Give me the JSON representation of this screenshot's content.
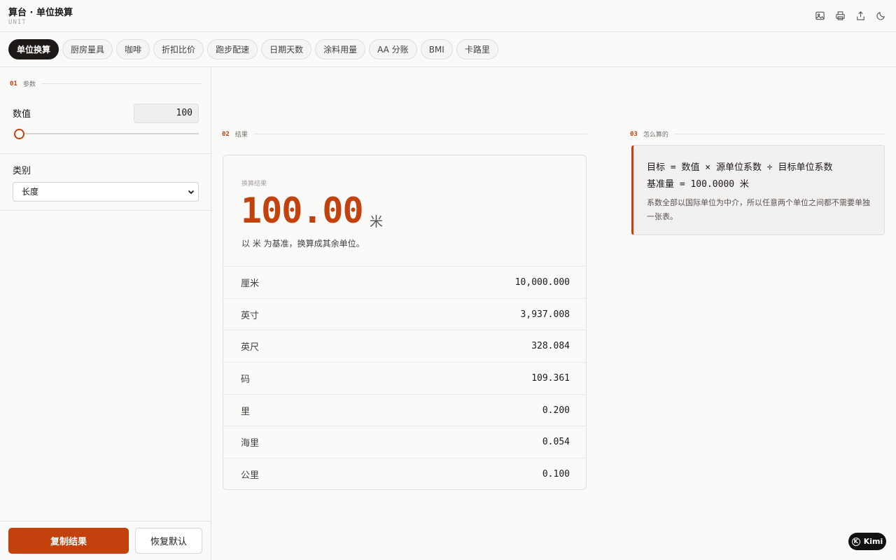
{
  "header": {
    "title": "算台 · 单位换算",
    "subtitle": "UNIT",
    "icons": [
      "image-icon",
      "print-icon",
      "share-icon",
      "moon-icon"
    ]
  },
  "tabs": [
    {
      "label": "单位换算",
      "active": true
    },
    {
      "label": "厨房量具",
      "active": false
    },
    {
      "label": "咖啡",
      "active": false
    },
    {
      "label": "折扣比价",
      "active": false
    },
    {
      "label": "跑步配速",
      "active": false
    },
    {
      "label": "日期天数",
      "active": false
    },
    {
      "label": "涂料用量",
      "active": false
    },
    {
      "label": "AA 分账",
      "active": false
    },
    {
      "label": "BMI",
      "active": false
    },
    {
      "label": "卡路里",
      "active": false
    }
  ],
  "params": {
    "section_num": "01",
    "section_label": "参数",
    "value_label": "数值",
    "value": "100",
    "slider_fraction": 0.0,
    "category_label": "类别",
    "category_value": "长度"
  },
  "actions": {
    "copy_label": "复制结果",
    "reset_label": "恢复默认"
  },
  "results": {
    "section_num": "02",
    "section_label": "结果",
    "caption": "换算结果",
    "value": "100.00",
    "unit": "米",
    "description": "以 米 为基准，换算成其余单位。",
    "rows": [
      {
        "name": "厘米",
        "value": "10,000.000"
      },
      {
        "name": "英寸",
        "value": "3,937.008"
      },
      {
        "name": "英尺",
        "value": "328.084"
      },
      {
        "name": "码",
        "value": "109.361"
      },
      {
        "name": "里",
        "value": "0.200"
      },
      {
        "name": "海里",
        "value": "0.054"
      },
      {
        "name": "公里",
        "value": "0.100"
      }
    ]
  },
  "formula": {
    "section_num": "03",
    "section_label": "怎么算的",
    "line1": "目标 = 数值 × 源单位系数 ÷ 目标单位系数",
    "line2": "基准量 = 100.0000 米",
    "note": "系数全部以国际单位为中介，所以任意两个单位之间都不需要单独一张表。"
  },
  "badge": {
    "label": "Kimi"
  },
  "colors": {
    "accent": "#c2410c",
    "dark": "#1c1917"
  }
}
